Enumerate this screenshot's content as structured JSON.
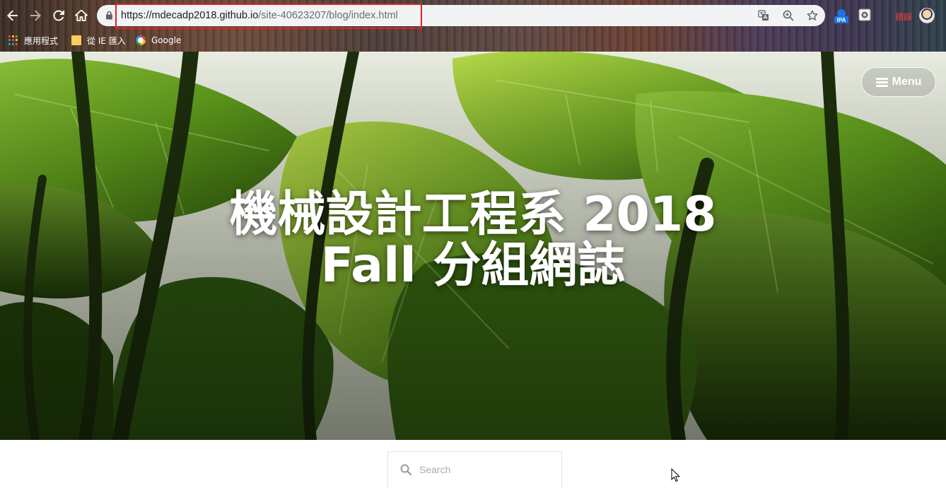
{
  "browser": {
    "url_host": "https://mdecadp2018.github.io",
    "url_path": "/site-40623207/blog/index.html",
    "profile_label": "錯誤",
    "extensions": [
      "translate-icon",
      "zoom-icon",
      "star-icon",
      "ipa-extension-icon",
      "screenshot-extension-icon"
    ],
    "ipa_label": "IPA"
  },
  "bookmarks": [
    {
      "label": "應用程式",
      "icon": "apps-icon"
    },
    {
      "label": "從 IE 匯入",
      "icon": "folder-icon"
    },
    {
      "label": "Google",
      "icon": "google-icon"
    }
  ],
  "hero": {
    "title_line1": "機械設計工程系 2018",
    "title_line2": "Fall 分組網誌",
    "menu_label": "Menu"
  },
  "search": {
    "placeholder": "Search"
  },
  "colors": {
    "highlight": "#e02424",
    "profile_text": "#ff3b30"
  }
}
